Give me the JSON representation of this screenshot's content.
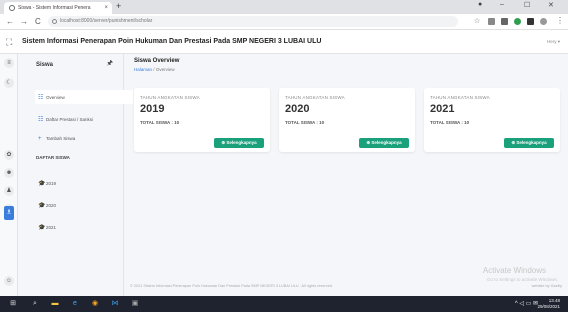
{
  "browser": {
    "tab_title": "Siswa - Sistem Informasi Penera",
    "tab_close": "×",
    "new_tab": "+",
    "url": "localhost:8000/server/punishment/scholar",
    "back": "←",
    "forward": "→",
    "reload": "C",
    "minimize": "–",
    "maximize": "☐",
    "close": "✕"
  },
  "app": {
    "title": "Sistem Informasi Penerapan Poin Hukuman Dan Prestasi Pada SMP NEGERI 3 LUBAI ULU",
    "user_menu": "Hery ▾"
  },
  "sidebar": {
    "title": "Siswa",
    "items": [
      {
        "label": "Overview",
        "icon": "list-icon"
      },
      {
        "label": "Daftar Prestasi / Sanksi",
        "icon": "list-icon"
      },
      {
        "label": "Tambah Siswa",
        "icon": "plus-icon"
      }
    ],
    "section_label": "DAFTAR SISWA",
    "years": [
      {
        "label": "2019",
        "icon": "graduation-cap-icon"
      },
      {
        "label": "2020",
        "icon": "graduation-cap-icon"
      },
      {
        "label": "2021",
        "icon": "graduation-cap-icon"
      }
    ]
  },
  "main": {
    "title": "Siswa Overview",
    "breadcrumb_home": "Halaman",
    "breadcrumb_sep": "/",
    "breadcrumb_current": "Overview",
    "cards": [
      {
        "label": "TAHUN ANGKATAN SISWA",
        "year": "2019",
        "total": "TOTAL SISWA : 10",
        "button": "⊕ Selengkapnya"
      },
      {
        "label": "TAHUN ANGKATAN SISWA",
        "year": "2020",
        "total": "TOTAL SISWA : 10",
        "button": "⊕ Selengkapnya"
      },
      {
        "label": "TAHUN ANGKATAN SISWA",
        "year": "2021",
        "total": "TOTAL SISWA : 10",
        "button": "⊕ Selengkapnya"
      }
    ],
    "footer": "© 2021 Sistem Informasi Penerapan Poin Hukuman Dan Prestasi Pada SMP NEGERI 3 LUBAI ULU . All rights reserved",
    "footer_right": "website by Gazilly"
  },
  "windows": {
    "watermark_title": "Activate Windows",
    "watermark_sub": "Go to Settings to activate Windows.",
    "time": "13.48",
    "date": "29/08/2021"
  },
  "colors": {
    "accent": "#3b7ddd",
    "button_green": "#1aa07a",
    "taskbar": "#1f2330"
  }
}
